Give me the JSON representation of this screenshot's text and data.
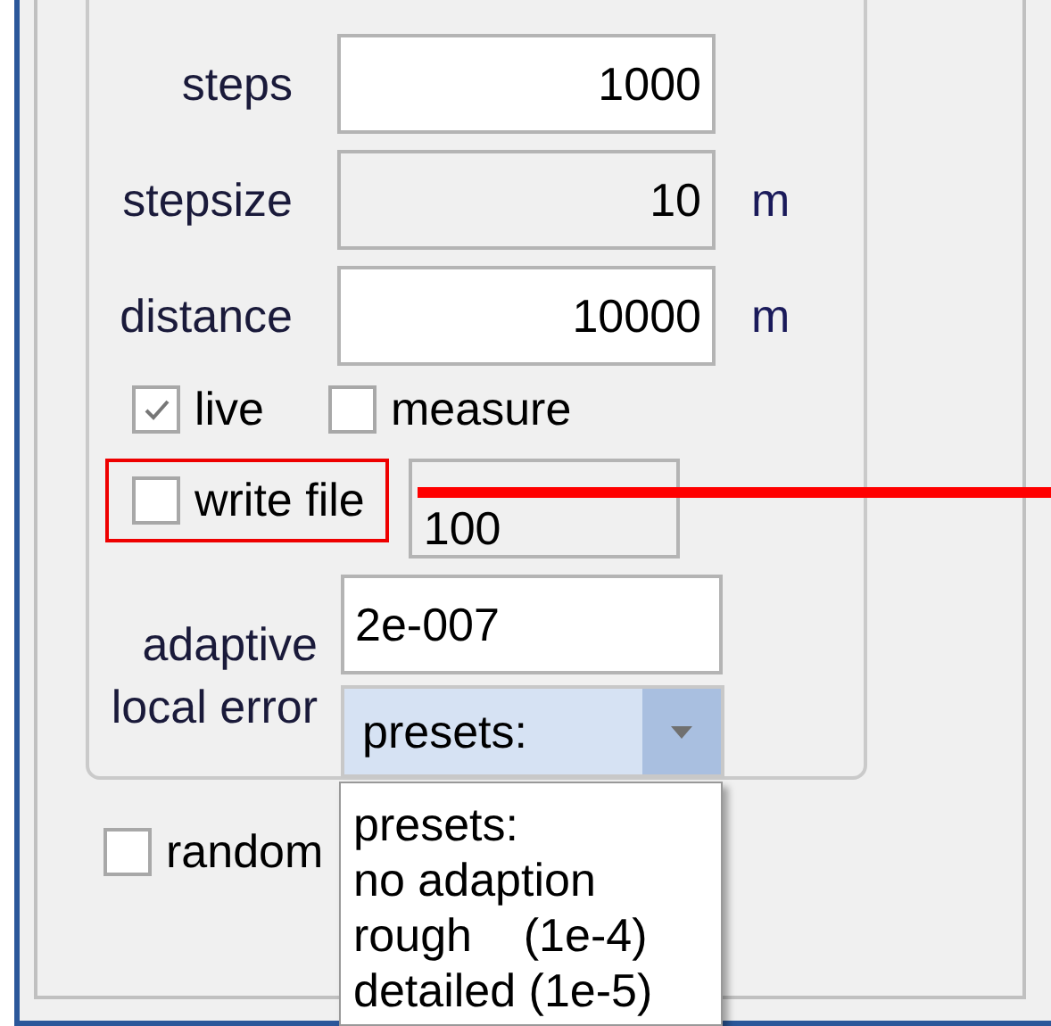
{
  "fields": [
    {
      "label": "steps",
      "value": "1000",
      "readonly": false
    },
    {
      "label": "stepsize",
      "value": "10",
      "unit": "m",
      "readonly": true
    },
    {
      "label": "distance",
      "value": "10000",
      "unit": "m",
      "readonly": false
    }
  ],
  "checkboxes": [
    {
      "label": "live",
      "checked": true
    },
    {
      "label": "measure",
      "checked": false
    }
  ],
  "write_file": {
    "label": "write file",
    "checked": false,
    "highlighted": true,
    "interval": "100"
  },
  "adaptive": {
    "label_lines": [
      "adaptive",
      "local error"
    ],
    "value": "2e-007",
    "combo": {
      "value": "presets:",
      "expanded": true,
      "options": [
        "presets:",
        "no adaption",
        "rough    (1e-4)",
        "detailed (1e-5)"
      ]
    }
  },
  "random": {
    "label": "random",
    "checked": false
  }
}
